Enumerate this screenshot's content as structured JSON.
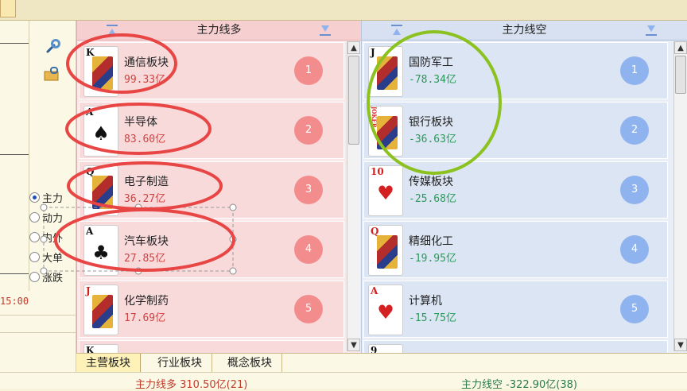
{
  "left_panel": {
    "radio_options": [
      {
        "label": "主力",
        "checked": true
      },
      {
        "label": "动力",
        "checked": false
      },
      {
        "label": "内外",
        "checked": false
      },
      {
        "label": "大单",
        "checked": false
      },
      {
        "label": "涨跌",
        "checked": false
      }
    ],
    "time_label": "15:00",
    "icons": [
      "wrench-icon",
      "folder-lock-icon"
    ]
  },
  "long_panel": {
    "title": "主力线多",
    "items": [
      {
        "name": "通信板块",
        "value": "99.33亿",
        "rank": "1",
        "card": {
          "rank": "K",
          "suit": "♣",
          "face": true,
          "color": "black"
        }
      },
      {
        "name": "半导体",
        "value": "83.60亿",
        "rank": "2",
        "card": {
          "rank": "A",
          "suit": "♠",
          "face": false,
          "color": "black"
        }
      },
      {
        "name": "电子制造",
        "value": "36.27亿",
        "rank": "3",
        "card": {
          "rank": "Q",
          "suit": "♠",
          "face": true,
          "color": "black"
        }
      },
      {
        "name": "汽车板块",
        "value": "27.85亿",
        "rank": "4",
        "card": {
          "rank": "A",
          "suit": "♣",
          "face": false,
          "color": "black"
        }
      },
      {
        "name": "化学制药",
        "value": "17.69亿",
        "rank": "5",
        "card": {
          "rank": "J",
          "suit": "♦",
          "face": true,
          "color": "red"
        }
      },
      {
        "name": "",
        "value": "",
        "rank": "",
        "card": {
          "rank": "K",
          "suit": "",
          "face": false,
          "color": "black"
        }
      }
    ]
  },
  "short_panel": {
    "title": "主力线空",
    "items": [
      {
        "name": "国防军工",
        "value": "-78.34亿",
        "rank": "1",
        "card": {
          "rank": "J",
          "suit": "♠",
          "face": true,
          "color": "black"
        }
      },
      {
        "name": "银行板块",
        "value": "-36.63亿",
        "rank": "2",
        "card": {
          "rank": "JOKER",
          "suit": "",
          "face": true,
          "color": "red"
        }
      },
      {
        "name": "传媒板块",
        "value": "-25.68亿",
        "rank": "3",
        "card": {
          "rank": "10",
          "suit": "♥",
          "face": false,
          "color": "red"
        }
      },
      {
        "name": "精细化工",
        "value": "-19.95亿",
        "rank": "4",
        "card": {
          "rank": "Q",
          "suit": "♦",
          "face": true,
          "color": "red"
        }
      },
      {
        "name": "计算机",
        "value": "-15.75亿",
        "rank": "5",
        "card": {
          "rank": "A",
          "suit": "♥",
          "face": false,
          "color": "red"
        }
      },
      {
        "name": "",
        "value": "",
        "rank": "",
        "card": {
          "rank": "9",
          "suit": "",
          "face": false,
          "color": "black"
        }
      }
    ]
  },
  "bottom_tabs": [
    {
      "label": "主营板块",
      "active": true
    },
    {
      "label": "行业板块",
      "active": false
    },
    {
      "label": "概念板块",
      "active": false
    }
  ],
  "status": {
    "long_total": "主力线多 310.50亿(21)",
    "short_total": "主力线空 -322.90亿(38)"
  },
  "colors": {
    "long_accent": "#f38d8d",
    "short_accent": "#8fb3ef",
    "long_value": "#d44040",
    "short_value": "#2a9a5a",
    "annotation_red": "#e84545",
    "annotation_green": "#8cc21f"
  }
}
